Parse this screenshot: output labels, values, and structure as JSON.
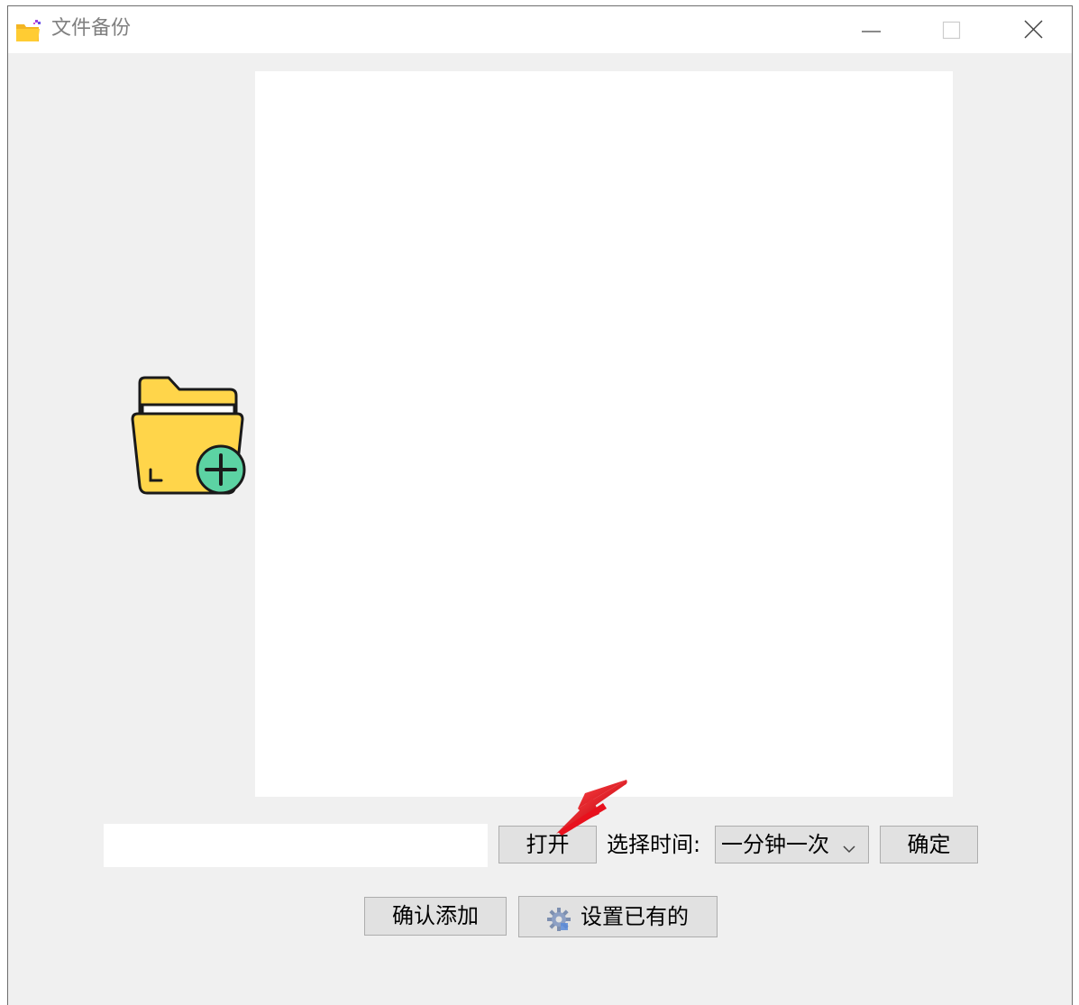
{
  "window": {
    "title": "文件备份",
    "controls": {
      "minimize_icon": "minimize-icon",
      "maximize_icon": "maximize-icon",
      "close_icon": "close-icon"
    }
  },
  "main": {
    "folder_icon": "folder-add-icon",
    "path_input": {
      "value": "",
      "placeholder": ""
    },
    "open_button_label": "打开",
    "time_label": "选择时间:",
    "time_select": {
      "selected": "一分钟一次"
    },
    "ok_button_label": "确定",
    "confirm_add_button_label": "确认添加",
    "settings_button": {
      "label": "设置已有的",
      "icon": "gear-icon"
    }
  },
  "colors": {
    "window_background": "#f0f0f0",
    "titlebar_background": "#ffffff",
    "button_background": "#e1e1e1",
    "button_border": "#adadad",
    "folder_yellow": "#ffd54a",
    "plus_circle_green": "#5cd3a3",
    "annotation_arrow": "#e8111d"
  }
}
